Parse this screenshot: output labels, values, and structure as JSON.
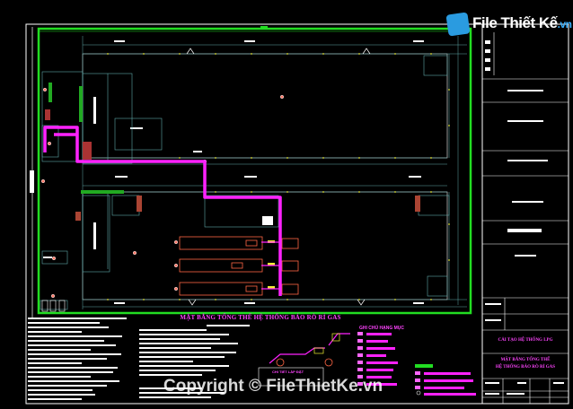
{
  "logo": {
    "name": "File Thiết Kế",
    "tld": ".vn"
  },
  "watermark": "Copyright © FileThietKe.vn",
  "drawing": {
    "title": "MẶT BẰNG TỔNG THỂ HỆ THỐNG BÁO RÒ RỈ GAS",
    "legend_title": "GHI CHÚ HẠNG MỤC",
    "detail_title": "CHI TIẾT LẮP ĐẶT"
  },
  "title_block": {
    "project": "CẢI TẠO HỆ THỐNG LPG",
    "sheet_title_line1": "MẶT BẰNG TỔNG THỂ",
    "sheet_title_line2": "HỆ THỐNG BÁO RÒ RỈ GAS"
  },
  "colors": {
    "background": "#000000",
    "boundary": "#22dd22",
    "gas_line": "#ff22ff",
    "wall": "#ffffff",
    "grid": "#5fa8a8",
    "brick": "#cc5544",
    "tank": "#ff6644"
  }
}
